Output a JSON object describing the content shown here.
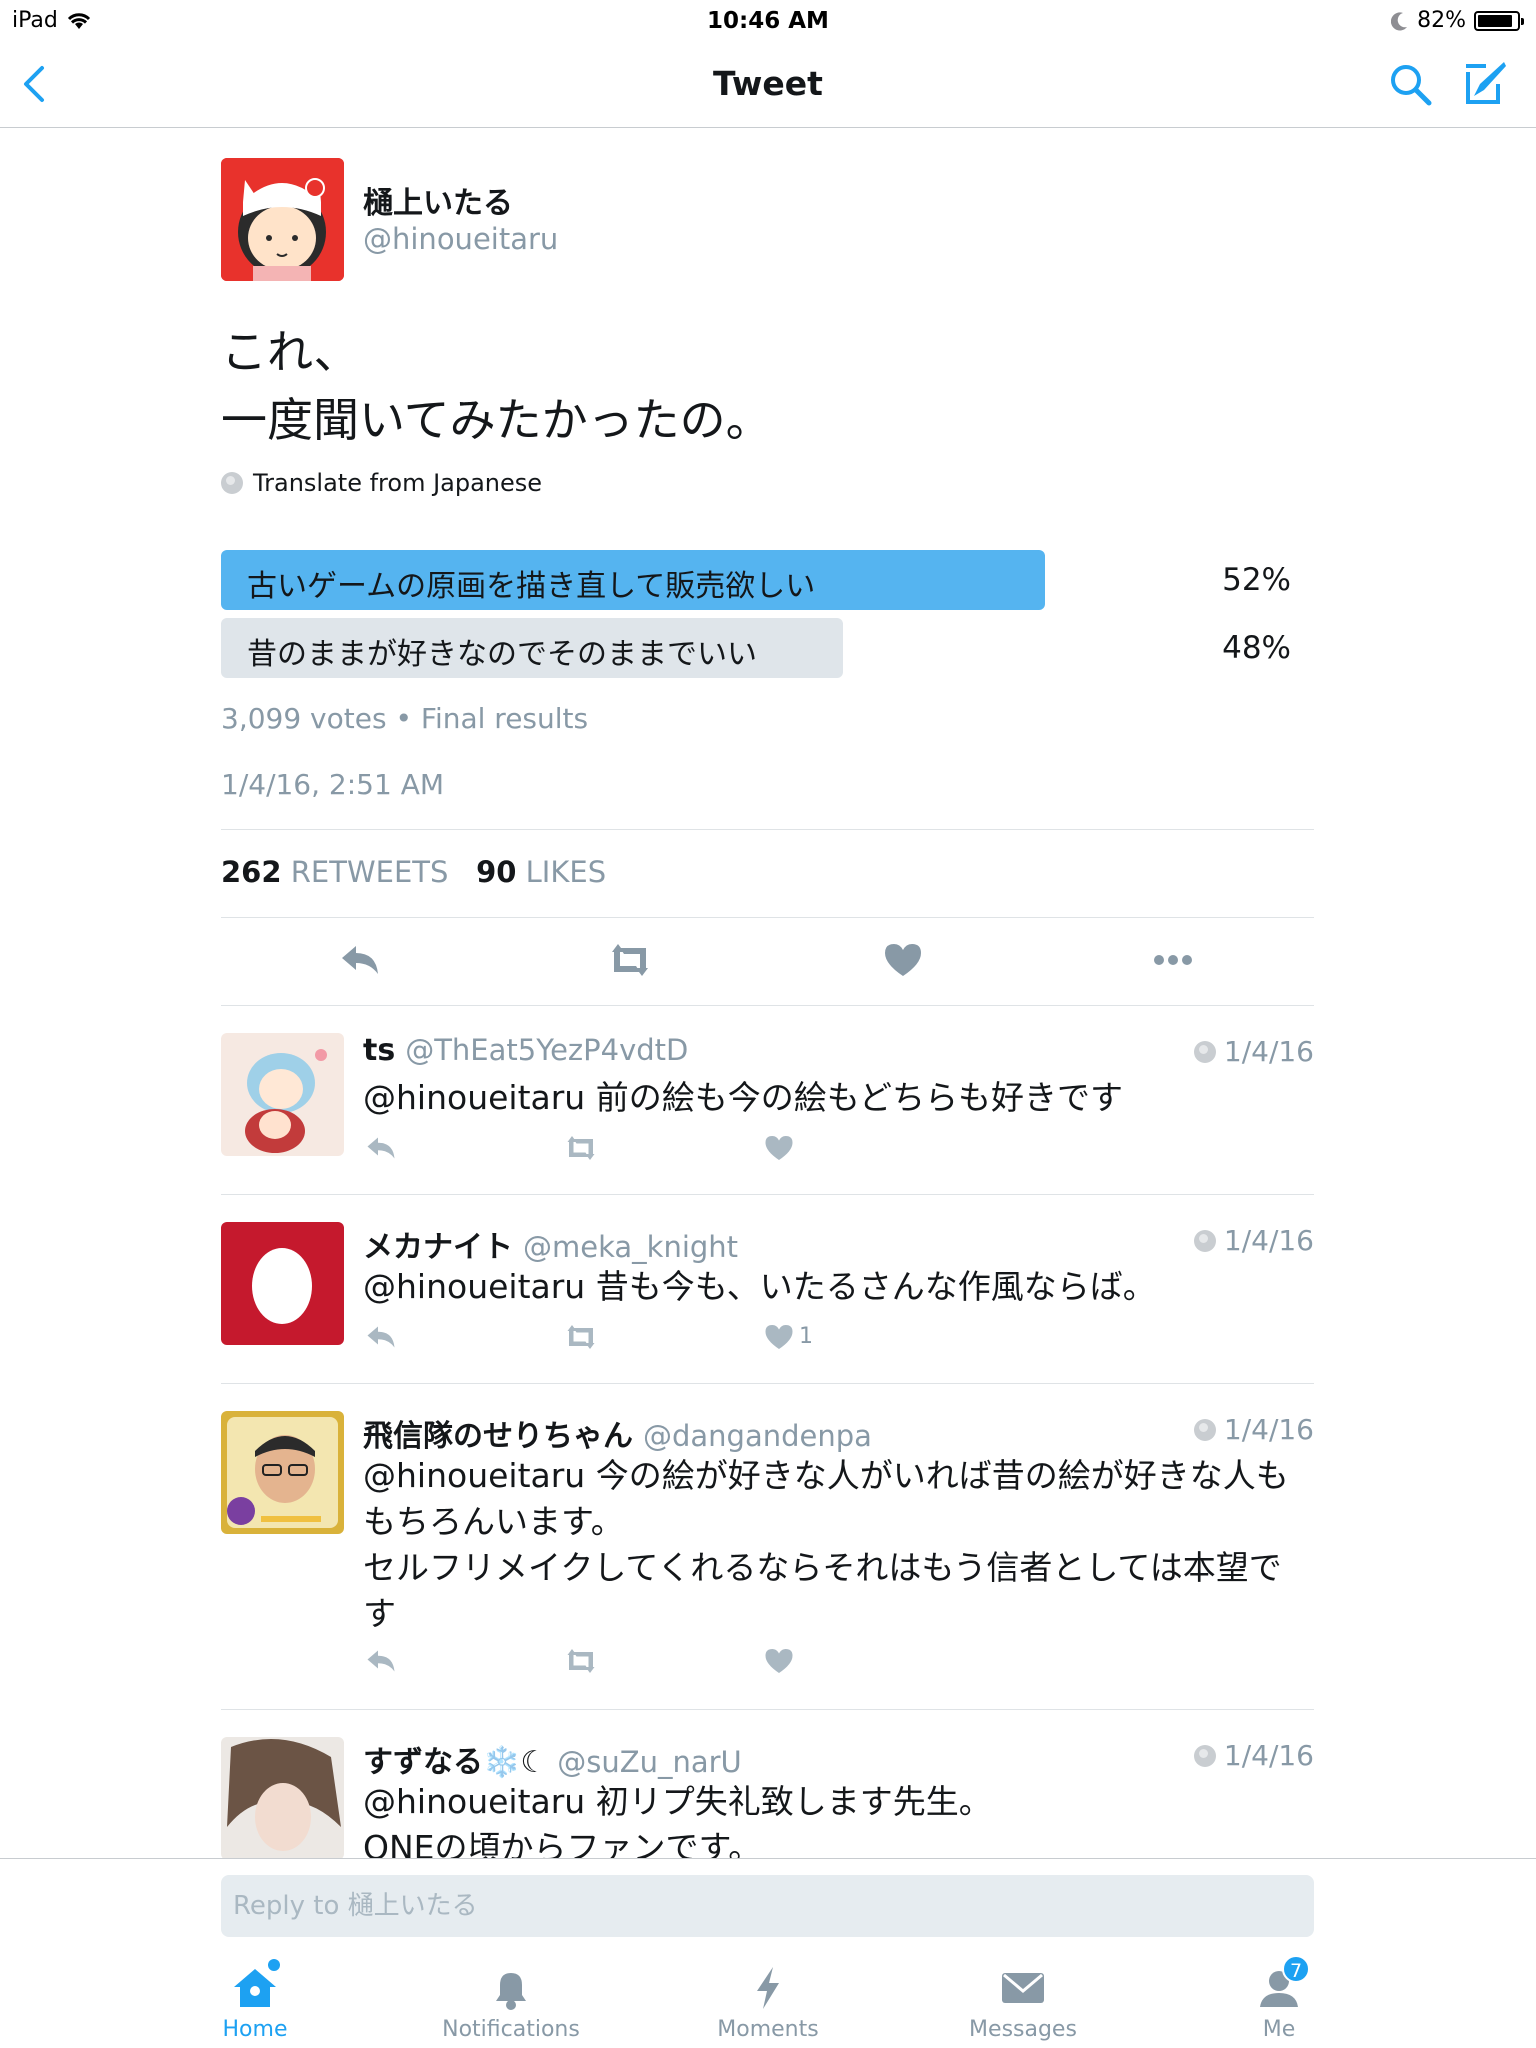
{
  "status_bar": {
    "device": "iPad",
    "time": "10:46 AM",
    "battery": "82%"
  },
  "nav": {
    "title": "Tweet"
  },
  "tweet": {
    "author_name": "樋上いたる",
    "author_handle": "@hinoueitaru",
    "text_line1": "これ、",
    "text_line2": "一度聞いてみたかったの。",
    "translate_label": "Translate from Japanese",
    "poll": {
      "options": [
        {
          "label": "古いゲームの原画を描き直して販売欲しい",
          "percent_label": "52%",
          "percent": 52,
          "color": "#55b4f0"
        },
        {
          "label": "昔のままが好きなのでそのままでいい",
          "percent_label": "48%",
          "percent": 48,
          "color": "#dfe5ea"
        }
      ],
      "meta": "3,099 votes • Final results"
    },
    "timestamp": "1/4/16, 2:51 AM",
    "stats": {
      "retweets_count": "262",
      "retweets_label": "RETWEETS",
      "likes_count": "90",
      "likes_label": "LIKES"
    }
  },
  "replies": [
    {
      "name": "ts",
      "handle": "@ThEat5YezP4vdtD",
      "date": "1/4/16",
      "text": "@hinoueitaru 前の絵も今の絵もどちらも好きです",
      "likes": ""
    },
    {
      "name": "メカナイト",
      "handle": "@meka_knight",
      "date": "1/4/16",
      "text": "@hinoueitaru 昔も今も、いたるさんな作風ならば。",
      "likes": "1"
    },
    {
      "name": "飛信隊のせりちゃん",
      "handle": "@dangandenpa",
      "date": "1/4/16",
      "text": "@hinoueitaru 今の絵が好きな人がいれば昔の絵が好きな人ももちろんいます。\nセルフリメイクしてくれるならそれはもう信者としては本望です",
      "likes": ""
    },
    {
      "name": "すずなる❄️☾",
      "handle": "@suZu_narU",
      "date": "1/4/16",
      "text": "@hinoueitaru 初リプ失礼致します先生。\nONEの頃からファンです。",
      "likes": ""
    }
  ],
  "reply_box": {
    "placeholder": "Reply to 樋上いたる"
  },
  "tabs": [
    {
      "label": "Home",
      "active": true
    },
    {
      "label": "Notifications"
    },
    {
      "label": "Moments"
    },
    {
      "label": "Messages"
    },
    {
      "label": "Me",
      "badge": "7"
    }
  ],
  "colors": {
    "accent": "#1da1f2",
    "poll_winner": "#55b4f0",
    "poll_other": "#dfe5ea",
    "muted": "#8899a6"
  }
}
